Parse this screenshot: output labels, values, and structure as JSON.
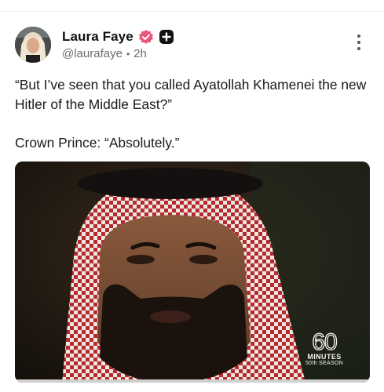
{
  "post": {
    "author_name": "Laura Faye",
    "handle": "@laurafaye",
    "separator": "•",
    "time": "2h",
    "body_line1": "“But I’ve seen that you called Ayatollah Khamenei the new Hitler of the Middle East?”",
    "body_line2": "Crown Prince: “Absolutely.”"
  },
  "media": {
    "logo_number": "60",
    "logo_word": "MINUTES",
    "logo_season": "50th SEASON"
  },
  "icons": {
    "verified": "verified-badge-icon",
    "plus": "plus-badge-icon",
    "more": "more-vertical-icon"
  },
  "colors": {
    "verified_badge": "#e8577a",
    "plus_badge": "#111111",
    "headdress_red": "#b52a2f"
  }
}
